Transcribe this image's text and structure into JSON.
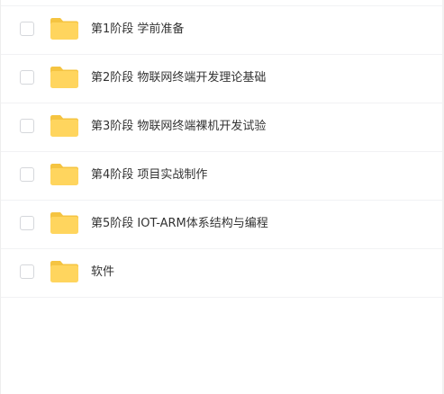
{
  "files": [
    {
      "name": "第1阶段 学前准备",
      "type": "folder-icon"
    },
    {
      "name": "第2阶段 物联网终端开发理论基础",
      "type": "folder-icon"
    },
    {
      "name": "第3阶段 物联网终端裸机开发试验",
      "type": "folder-icon"
    },
    {
      "name": "第4阶段 项目实战制作",
      "type": "folder-icon"
    },
    {
      "name": "第5阶段 IOT-ARM体系结构与编程",
      "type": "folder-icon"
    },
    {
      "name": "软件",
      "type": "folder-icon"
    }
  ],
  "colors": {
    "folder": "#FFD55E",
    "folder_tab": "#F5C441",
    "text": "#333333",
    "divider": "#F1F2F4",
    "checkbox_border": "#D5D7DB"
  }
}
